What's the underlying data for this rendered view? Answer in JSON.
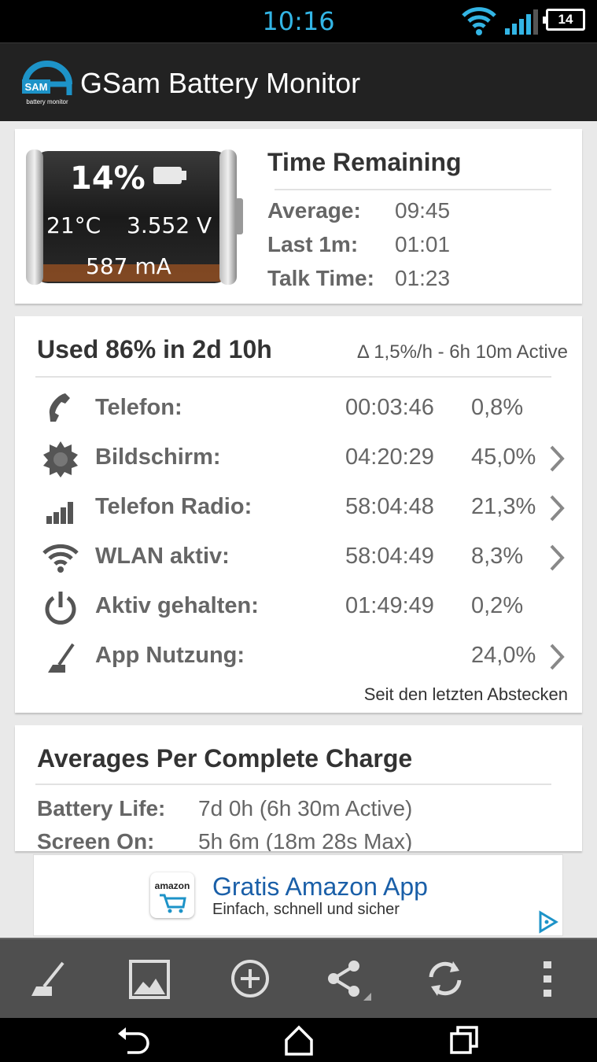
{
  "status_bar": {
    "time": "10:16",
    "battery_level": "14",
    "icons": [
      "wifi-icon",
      "signal-icon",
      "battery-icon"
    ],
    "accent_color": "#33b5e5"
  },
  "action_bar": {
    "logo_icon": "gsam-logo-icon",
    "logo_text": "SAM",
    "logo_subtext": "battery monitor",
    "title": "GSam Battery Monitor"
  },
  "battery_card": {
    "percent": "14%",
    "temperature": "21°C",
    "voltage": "3.552 V",
    "current": "587 mA",
    "time_remaining": {
      "title": "Time Remaining",
      "rows": [
        {
          "label": "Average:",
          "value": "09:45"
        },
        {
          "label": "Last 1m:",
          "value": "01:01"
        },
        {
          "label": "Talk Time:",
          "value": "01:23"
        }
      ]
    }
  },
  "usage_card": {
    "title": "Used 86% in 2d 10h",
    "subtitle": "Δ 1,5%/h - 6h 10m Active",
    "rows": [
      {
        "icon": "phone-icon",
        "label": "Telefon:",
        "time": "00:03:46",
        "percent": "0,8%",
        "chevron": false
      },
      {
        "icon": "brightness-icon",
        "label": "Bildschirm:",
        "time": "04:20:29",
        "percent": "45,0%",
        "chevron": true
      },
      {
        "icon": "signal-bars-icon",
        "label": "Telefon Radio:",
        "time": "58:04:48",
        "percent": "21,3%",
        "chevron": true
      },
      {
        "icon": "wifi-icon",
        "label": "WLAN aktiv:",
        "time": "58:04:49",
        "percent": "8,3%",
        "chevron": true
      },
      {
        "icon": "power-icon",
        "label": "Aktiv gehalten:",
        "time": "01:49:49",
        "percent": "0,2%",
        "chevron": false
      },
      {
        "icon": "gauge-icon",
        "label": "App Nutzung:",
        "time": "",
        "percent": "24,0%",
        "chevron": true
      }
    ],
    "footer": "Seit den letzten Abstecken"
  },
  "averages_card": {
    "title": "Averages Per Complete Charge",
    "rows": [
      {
        "label": "Battery Life:",
        "value": "7d 0h (6h 30m Active)"
      },
      {
        "label": "Screen On:",
        "value": "5h 6m (18m 28s Max)"
      }
    ]
  },
  "ad": {
    "logo_text": "amazon",
    "title": "Gratis Amazon App",
    "subtitle": "Einfach, schnell und sicher",
    "icon": "adchoices-icon"
  },
  "bottom_bar": {
    "buttons": [
      "gauge-icon",
      "image-icon",
      "add-circle-icon",
      "share-icon",
      "refresh-icon",
      "overflow-menu-icon"
    ]
  },
  "nav_bar": {
    "buttons": [
      "back-icon",
      "home-icon",
      "recents-icon"
    ]
  }
}
